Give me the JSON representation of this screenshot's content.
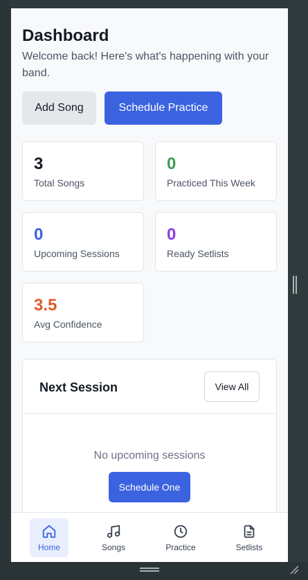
{
  "header": {
    "title": "Dashboard",
    "subtitle": "Welcome back! Here's what's happening with your band."
  },
  "actions": {
    "add_song": "Add Song",
    "schedule_practice": "Schedule Practice"
  },
  "stats": [
    {
      "value": "3",
      "label": "Total Songs",
      "color": "#141a24"
    },
    {
      "value": "0",
      "label": "Practiced This Week",
      "color": "#3f9c4f"
    },
    {
      "value": "0",
      "label": "Upcoming Sessions",
      "color": "#3b63e0"
    },
    {
      "value": "0",
      "label": "Ready Setlists",
      "color": "#8b3fe0"
    },
    {
      "value": "3.5",
      "label": "Avg Confidence",
      "color": "#e05a2b"
    }
  ],
  "next_session": {
    "title": "Next Session",
    "view_all": "View All",
    "empty_text": "No upcoming sessions",
    "schedule_one": "Schedule One"
  },
  "nav": [
    {
      "label": "Home",
      "icon": "home-icon",
      "active": true
    },
    {
      "label": "Songs",
      "icon": "music-note-icon",
      "active": false
    },
    {
      "label": "Practice",
      "icon": "clock-icon",
      "active": false
    },
    {
      "label": "Setlists",
      "icon": "document-icon",
      "active": false
    }
  ],
  "colors": {
    "accent": "#3b63e0",
    "background": "#f8f9fb"
  }
}
